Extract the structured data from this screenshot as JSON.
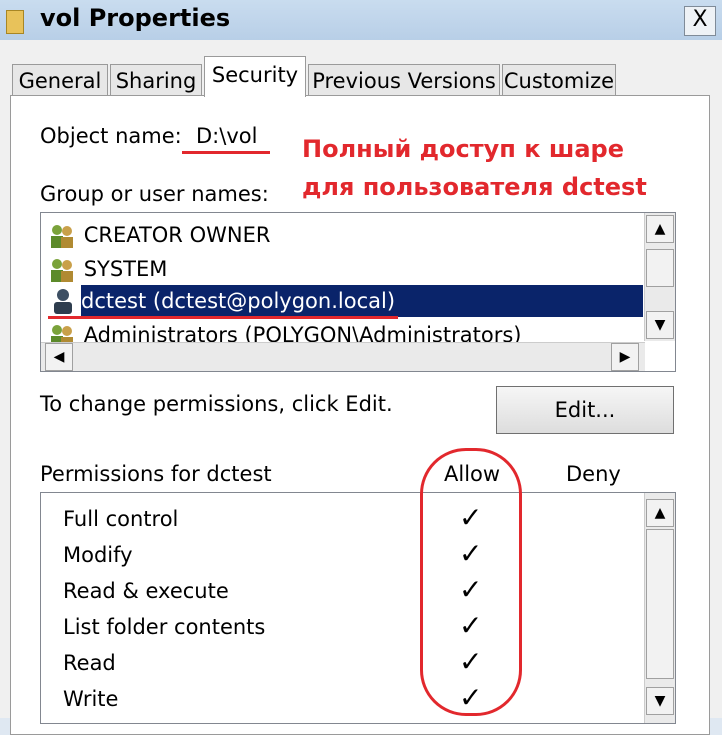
{
  "window": {
    "title": "vol Properties",
    "close_symbol": "X"
  },
  "tabs": [
    "General",
    "Sharing",
    "Security",
    "Previous Versions",
    "Customize"
  ],
  "security": {
    "object_label": "Object name:",
    "object_value": "D:\\vol",
    "group_label": "Group or user names:",
    "users": [
      "CREATOR OWNER",
      "SYSTEM",
      "dctest (dctest@polygon.local)",
      "Administrators (POLYGON\\Administrators)"
    ],
    "selected_index": 2,
    "change_text": "To change permissions, click Edit.",
    "edit_button": "Edit...",
    "permissions_label": "Permissions for dctest",
    "allow_label": "Allow",
    "deny_label": "Deny",
    "permissions": [
      {
        "name": "Full control",
        "allow": "✓"
      },
      {
        "name": "Modify",
        "allow": "✓"
      },
      {
        "name": "Read & execute",
        "allow": "✓"
      },
      {
        "name": "List folder contents",
        "allow": "✓"
      },
      {
        "name": "Read",
        "allow": "✓"
      },
      {
        "name": "Write",
        "allow": "✓"
      }
    ]
  },
  "annotation": {
    "line1": "Полный доступ к шаре",
    "line2": "для пользователя dctest",
    "color": "#e2282d"
  }
}
